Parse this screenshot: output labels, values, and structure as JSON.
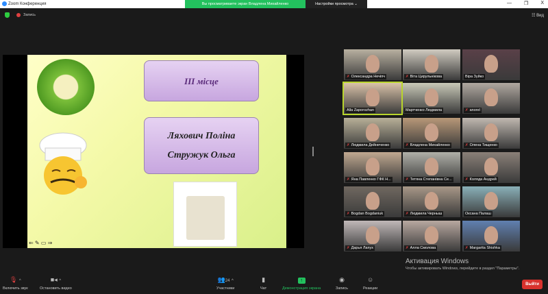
{
  "window": {
    "title": "Zoom Конференция",
    "minimize": "—",
    "restore": "❐",
    "close": "X"
  },
  "share_banner": {
    "message": "Вы просматриваете экран Владлена Михайленко",
    "view_options": "Настройки просмотра ⌄"
  },
  "topbar": {
    "record_label": "Запись",
    "view_label": "☷ Вид"
  },
  "slide": {
    "place": "ІІІ місце",
    "name1": "Ляхович Поліна",
    "name2": "Стружук Ольга",
    "nav": "⇐ ✎ ▭ ⇒"
  },
  "participants": [
    {
      "name": "Олександра Нечіпч",
      "muted": true,
      "bg": "#b8b0a0"
    },
    {
      "name": "Віта Цирульнікова",
      "muted": true,
      "bg": "#d0cbc0"
    },
    {
      "name": "Віра Зуйко",
      "muted": false,
      "bg": "#5a4048"
    },
    {
      "name": "Alla Zaporozhan",
      "muted": false,
      "bg": "#d9c2a8",
      "active": true
    },
    {
      "name": "Мартченко Людмила",
      "muted": false,
      "bg": "#c9c9b8"
    },
    {
      "name": "anorel",
      "muted": true,
      "bg": "#b0a8a0"
    },
    {
      "name": "Людмила Дейнеченко",
      "muted": true,
      "bg": "#b8b098"
    },
    {
      "name": "Владлена Михайленко",
      "muted": true,
      "bg": "#b89878"
    },
    {
      "name": "Олена Тищенко",
      "muted": true,
      "bg": "#c0b8b0"
    },
    {
      "name": "Яна Павленко ГФК Н...",
      "muted": true,
      "bg": "#c0a890"
    },
    {
      "name": "Тетяна Степанівна Се...",
      "muted": true,
      "bg": "#b0b0a8"
    },
    {
      "name": "Коляда Андрей",
      "muted": true,
      "bg": "#8a8078"
    },
    {
      "name": "Bogdan Bogdaniuk",
      "muted": true,
      "bg": "#706860"
    },
    {
      "name": "Людмила Черныш",
      "muted": true,
      "bg": "#a89888"
    },
    {
      "name": "Оксана Палаш",
      "muted": false,
      "bg": "#8ab0b8"
    },
    {
      "name": "Дарья Лапух",
      "muted": true,
      "bg": "#c0b8b8"
    },
    {
      "name": "Алла Смолова",
      "muted": true,
      "bg": "#b8a8a0"
    },
    {
      "name": "Margarita Shishka",
      "muted": true,
      "bg": "#6080b0"
    }
  ],
  "activation": {
    "title": "Активация Windows",
    "text": "Чтобы активировать Windows, перейдите в раздел \"Параметры\"."
  },
  "toolbar": {
    "unmute": "Включить звук",
    "stop_video": "Остановить видео",
    "participants": "Участники",
    "participants_count": "24",
    "chat": "Чат",
    "share": "Демонстрация экрана",
    "record": "Запись",
    "reactions": "Реакции",
    "leave": "Выйти"
  }
}
